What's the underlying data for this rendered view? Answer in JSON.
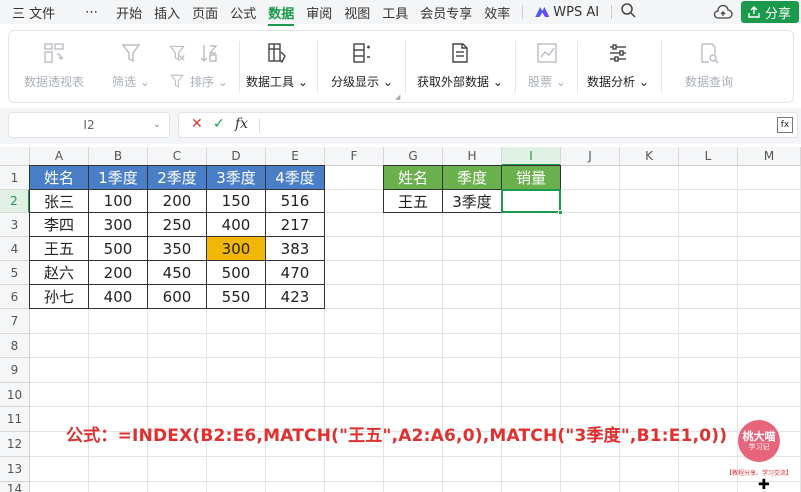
{
  "menubar": {
    "items": [
      "三 文件",
      "⋯",
      "开始",
      "插入",
      "页面",
      "公式",
      "数据",
      "审阅",
      "视图",
      "工具",
      "会员专享",
      "效率"
    ],
    "active": "数据",
    "wps_ai": "WPS AI",
    "share": "分享"
  },
  "ribbon": {
    "groups": [
      {
        "label": "数据透视表",
        "icon": "pivot-table-icon",
        "disabled": true
      },
      {
        "label": "筛选",
        "icon": "filter-icon",
        "disabled": true
      },
      {
        "label": "排序",
        "icon": "sort-icon",
        "disabled": true
      },
      {
        "label": "数据工具",
        "icon": "data-tools-icon",
        "disabled": false
      },
      {
        "label": "分级显示",
        "icon": "outline-icon",
        "disabled": false
      },
      {
        "label": "获取外部数据",
        "icon": "external-data-icon",
        "disabled": false
      },
      {
        "label": "股票",
        "icon": "stock-icon",
        "disabled": true
      },
      {
        "label": "数据分析",
        "icon": "data-analysis-icon",
        "disabled": false
      },
      {
        "label": "数据查询",
        "icon": "data-query-icon",
        "disabled": true
      }
    ]
  },
  "formula_bar": {
    "name_box": "I2",
    "cancel": "✕",
    "confirm": "✓",
    "fx": "fx",
    "content": ""
  },
  "grid": {
    "columns": [
      "A",
      "B",
      "C",
      "D",
      "E",
      "F",
      "G",
      "H",
      "I",
      "J",
      "K",
      "L",
      "M"
    ],
    "rows": [
      "1",
      "2",
      "3",
      "4",
      "5",
      "6",
      "7",
      "8",
      "9",
      "10",
      "11",
      "12",
      "13",
      "14"
    ],
    "selected_column": "I",
    "selected_row": "2",
    "table1": {
      "headers": [
        "姓名",
        "1季度",
        "2季度",
        "3季度",
        "4季度"
      ],
      "rows": [
        [
          "张三",
          "100",
          "200",
          "150",
          "516"
        ],
        [
          "李四",
          "300",
          "250",
          "400",
          "217"
        ],
        [
          "王五",
          "500",
          "350",
          "300",
          "383"
        ],
        [
          "赵六",
          "200",
          "450",
          "500",
          "470"
        ],
        [
          "孙七",
          "400",
          "600",
          "550",
          "423"
        ]
      ],
      "highlight_color": "#f2b705"
    },
    "table2": {
      "headers": [
        "姓名",
        "季度",
        "销量"
      ],
      "row": [
        "王五",
        "3季度",
        ""
      ]
    }
  },
  "annotation": "公式：=INDEX(B2:E6,MATCH(\"王五\",A2:A6,0),MATCH(\"3季度\",B1:E1,0))",
  "badge": {
    "line1": "桃大喵",
    "line2": "学习记",
    "sub": "【教程分享、学习交流】"
  }
}
